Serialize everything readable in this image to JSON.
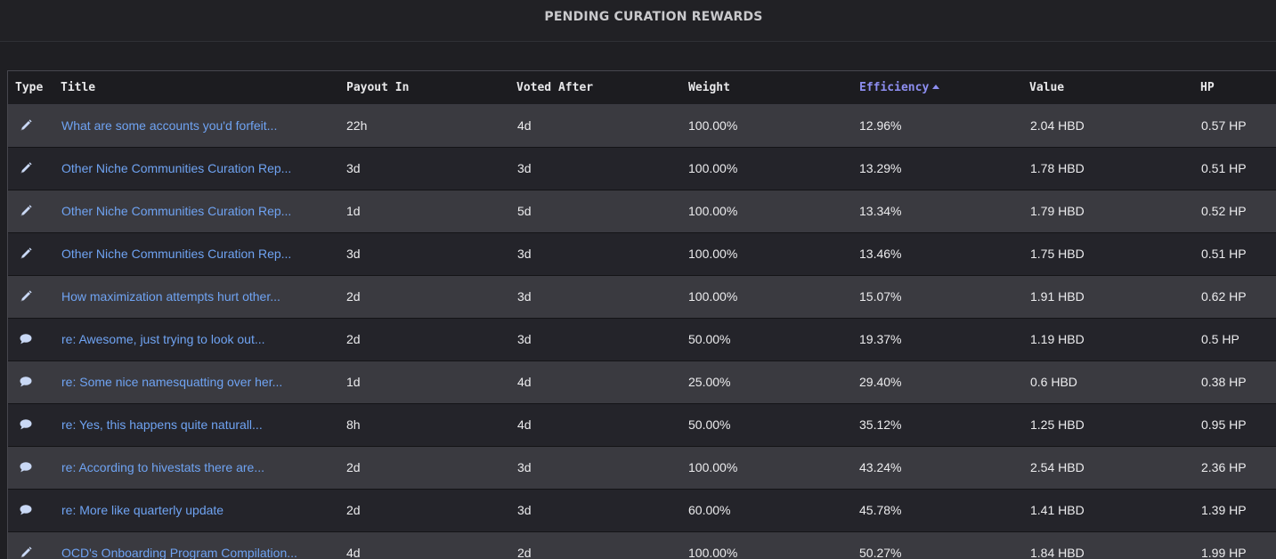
{
  "header": {
    "title": "PENDING CURATION REWARDS"
  },
  "colors": {
    "link": "#6fa3f2",
    "sort_active": "#8d8ef0",
    "icon": "#c9d8f5"
  },
  "table": {
    "columns": [
      {
        "label": "Type"
      },
      {
        "label": "Title"
      },
      {
        "label": "Payout In"
      },
      {
        "label": "Voted After"
      },
      {
        "label": "Weight"
      },
      {
        "label": "Efficiency",
        "sorted": "ascending"
      },
      {
        "label": "Value"
      },
      {
        "label": "HP"
      }
    ],
    "rows": [
      {
        "type": "pencil-icon",
        "title": "What are some accounts you'd forfeit...",
        "payout_in": "22h",
        "voted_after": "4d",
        "weight": "100.00%",
        "efficiency": "12.96%",
        "value": "2.04 HBD",
        "hp": "0.57 HP"
      },
      {
        "type": "pencil-icon",
        "title": "Other Niche Communities Curation Rep...",
        "payout_in": "3d",
        "voted_after": "3d",
        "weight": "100.00%",
        "efficiency": "13.29%",
        "value": "1.78 HBD",
        "hp": "0.51 HP"
      },
      {
        "type": "pencil-icon",
        "title": "Other Niche Communities Curation Rep...",
        "payout_in": "1d",
        "voted_after": "5d",
        "weight": "100.00%",
        "efficiency": "13.34%",
        "value": "1.79 HBD",
        "hp": "0.52 HP"
      },
      {
        "type": "pencil-icon",
        "title": "Other Niche Communities Curation Rep...",
        "payout_in": "3d",
        "voted_after": "3d",
        "weight": "100.00%",
        "efficiency": "13.46%",
        "value": "1.75 HBD",
        "hp": "0.51 HP"
      },
      {
        "type": "pencil-icon",
        "title": "How maximization attempts hurt other...",
        "payout_in": "2d",
        "voted_after": "3d",
        "weight": "100.00%",
        "efficiency": "15.07%",
        "value": "1.91 HBD",
        "hp": "0.62 HP"
      },
      {
        "type": "comment-icon",
        "title": "re: Awesome, just trying to look out...",
        "payout_in": "2d",
        "voted_after": "3d",
        "weight": "50.00%",
        "efficiency": "19.37%",
        "value": "1.19 HBD",
        "hp": "0.5 HP"
      },
      {
        "type": "comment-icon",
        "title": "re: Some nice namesquatting over her...",
        "payout_in": "1d",
        "voted_after": "4d",
        "weight": "25.00%",
        "efficiency": "29.40%",
        "value": "0.6 HBD",
        "hp": "0.38 HP"
      },
      {
        "type": "comment-icon",
        "title": "re: Yes, this happens quite naturall...",
        "payout_in": "8h",
        "voted_after": "4d",
        "weight": "50.00%",
        "efficiency": "35.12%",
        "value": "1.25 HBD",
        "hp": "0.95 HP"
      },
      {
        "type": "comment-icon",
        "title": "re: According to hivestats there are...",
        "payout_in": "2d",
        "voted_after": "3d",
        "weight": "100.00%",
        "efficiency": "43.24%",
        "value": "2.54 HBD",
        "hp": "2.36 HP"
      },
      {
        "type": "comment-icon",
        "title": "re: More like quarterly update",
        "payout_in": "2d",
        "voted_after": "3d",
        "weight": "60.00%",
        "efficiency": "45.78%",
        "value": "1.41 HBD",
        "hp": "1.39 HP"
      },
      {
        "type": "pencil-icon",
        "title": "OCD's Onboarding Program Compilation...",
        "payout_in": "4d",
        "voted_after": "2d",
        "weight": "100.00%",
        "efficiency": "50.27%",
        "value": "1.84 HBD",
        "hp": "1.99 HP"
      }
    ]
  }
}
